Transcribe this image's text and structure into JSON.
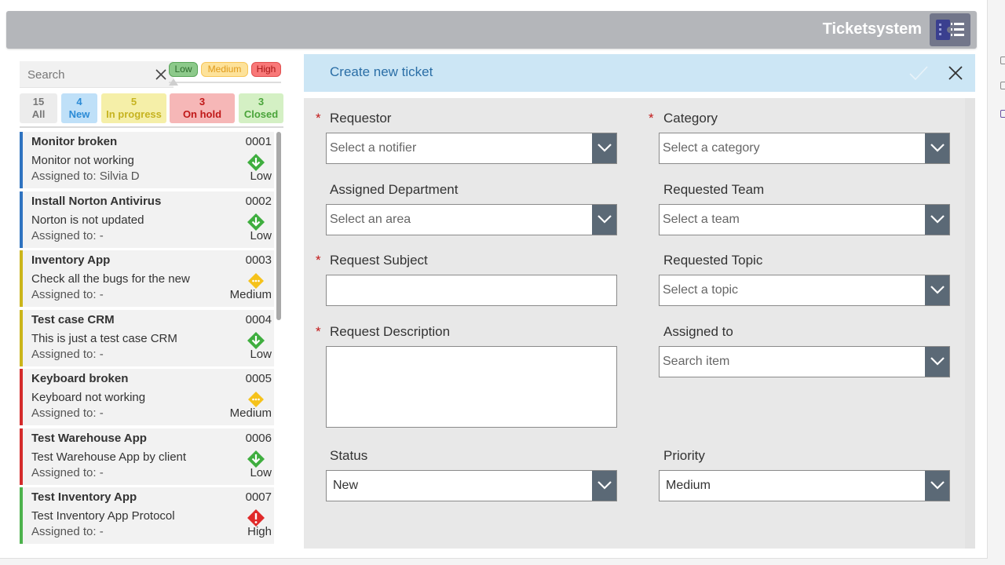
{
  "app": {
    "title": "Ticketsystem",
    "logo_icon": "ticket-list-icon"
  },
  "search": {
    "placeholder": "Search"
  },
  "priority_filter": {
    "low": "Low",
    "medium": "Medium",
    "high": "High"
  },
  "status_tabs": [
    {
      "count": "15",
      "label": "All"
    },
    {
      "count": "4",
      "label": "New"
    },
    {
      "count": "5",
      "label": "In progress"
    },
    {
      "count": "3",
      "label": "On hold"
    },
    {
      "count": "3",
      "label": "Closed"
    }
  ],
  "tickets": [
    {
      "title": "Monitor broken",
      "id": "0001",
      "description": "Monitor not working",
      "assigned": "Assigned to: Silvia D",
      "priority": "Low",
      "status_color": "#2f73c0",
      "priority_icon": "arrow-down-diamond-icon"
    },
    {
      "title": "Install Norton Antivirus",
      "id": "0002",
      "description": "Norton is not updated",
      "assigned": "Assigned to: -",
      "priority": "Low",
      "status_color": "#2f73c0",
      "priority_icon": "arrow-down-diamond-icon"
    },
    {
      "title": "Inventory App",
      "id": "0003",
      "description": "Check all the bugs for the new",
      "assigned": "Assigned to: -",
      "priority": "Medium",
      "status_color": "#cbb51a",
      "priority_icon": "dots-diamond-icon"
    },
    {
      "title": "Test case CRM",
      "id": "0004",
      "description": "This is just a test case CRM",
      "assigned": "Assigned to: -",
      "priority": "Low",
      "status_color": "#cbb51a",
      "priority_icon": "arrow-down-diamond-icon"
    },
    {
      "title": "Keyboard broken",
      "id": "0005",
      "description": "Keyboard not working",
      "assigned": "Assigned to: -",
      "priority": "Medium",
      "status_color": "#d42b2b",
      "priority_icon": "dots-diamond-icon"
    },
    {
      "title": "Test Warehouse App",
      "id": "0006",
      "description": "Test Warehouse App by client",
      "assigned": "Assigned to: -",
      "priority": "Low",
      "status_color": "#d42b2b",
      "priority_icon": "arrow-down-diamond-icon"
    },
    {
      "title": "Test Inventory App",
      "id": "0007",
      "description": "Test Inventory App Protocol",
      "assigned": "Assigned to: -",
      "priority": "High",
      "status_color": "#4cb24c",
      "priority_icon": "exclamation-diamond-icon"
    }
  ],
  "form": {
    "title": "Create new ticket",
    "requestor": {
      "label": "Requestor",
      "placeholder": "Select a notifier"
    },
    "category": {
      "label": "Category",
      "placeholder": "Select a category"
    },
    "department": {
      "label": "Assigned Department",
      "placeholder": "Select an area"
    },
    "team": {
      "label": "Requested Team",
      "placeholder": "Select a team"
    },
    "subject": {
      "label": "Request Subject",
      "value": ""
    },
    "topic": {
      "label": "Requested Topic",
      "placeholder": "Select a topic"
    },
    "description": {
      "label": "Request Description",
      "value": ""
    },
    "assigned_to": {
      "label": "Assigned to",
      "placeholder": "Search item"
    },
    "status": {
      "label": "Status",
      "value": "New"
    },
    "priority": {
      "label": "Priority",
      "value": "Medium"
    },
    "required_mark": "*"
  }
}
